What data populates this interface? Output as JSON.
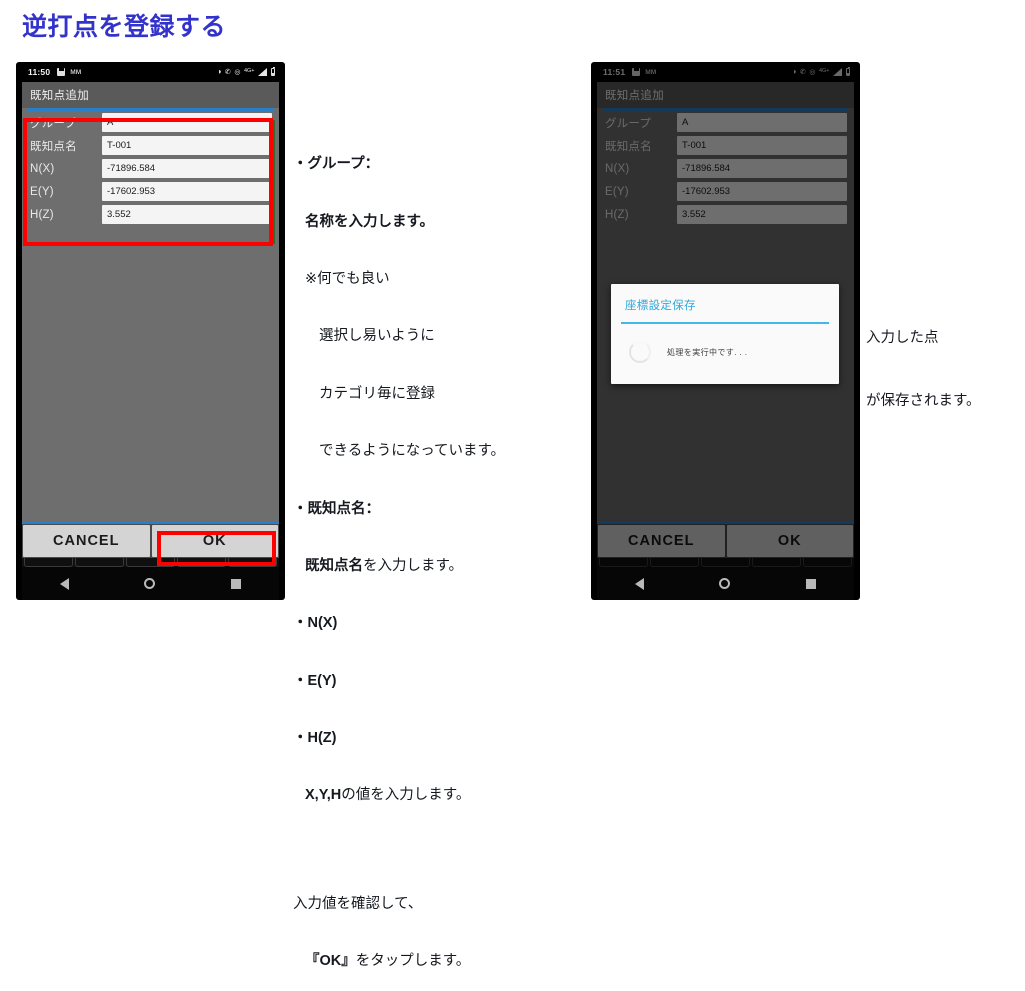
{
  "page": {
    "title": "逆打点を登録する"
  },
  "phone1": {
    "status": {
      "time": "11:50",
      "icons_left": [
        "save-icon",
        "m-logo-icon"
      ],
      "icons_right": [
        "do-not-disturb-icon",
        "phone-icon",
        "alarm-icon",
        "network-4g-plus-icon",
        "signal-icon",
        "battery-icon"
      ],
      "network_label": "4G+"
    },
    "appbar": {
      "title": "既知点追加"
    },
    "form": {
      "rows": [
        {
          "label": "グループ",
          "value": "A"
        },
        {
          "label": "既知点名",
          "value": "T-001"
        },
        {
          "label": "N(X)",
          "value": "-71896.584"
        },
        {
          "label": "E(Y)",
          "value": "-17602.953"
        },
        {
          "label": "H(Z)",
          "value": "3.552"
        }
      ]
    },
    "buttons": {
      "cancel": "CANCEL",
      "ok": "OK"
    },
    "nav": [
      "back-icon",
      "home-icon",
      "recents-icon"
    ]
  },
  "phone2": {
    "status": {
      "time": "11:51",
      "network_label": "4G+"
    },
    "appbar": {
      "title": "既知点追加"
    },
    "form": {
      "rows": [
        {
          "label": "グループ",
          "value": "A"
        },
        {
          "label": "既知点名",
          "value": "T-001"
        },
        {
          "label": "N(X)",
          "value": "-71896.584"
        },
        {
          "label": "E(Y)",
          "value": "-17602.953"
        },
        {
          "label": "H(Z)",
          "value": "3.552"
        }
      ]
    },
    "dialog": {
      "title": "座標設定保存",
      "message": "処理を実行中です. . ."
    },
    "buttons": {
      "cancel": "CANCEL",
      "ok": "OK"
    },
    "nav": [
      "back-icon",
      "home-icon",
      "recents-icon"
    ]
  },
  "annotations": {
    "main": {
      "l1": "・グループ：",
      "l2": "名称を入力します。",
      "l3": "※何でも良い",
      "l4": "選択し易いように",
      "l5": "カテゴリ毎に登録",
      "l6": "できるようになっています。",
      "l7": "・既知点名：",
      "l8a": "既知点名",
      "l8b": "を入力します。",
      "l9": "・N(X)",
      "l10": "・E(Y)",
      "l11": "・H(Z)",
      "l12a": "X,Y,H",
      "l12b": "の値を入力します。",
      "l13": "入力値を確認して、",
      "l14a": "『OK』",
      "l14b": "をタップします。"
    },
    "right": {
      "l1": "入力した点",
      "l2": "が保存されます。"
    }
  },
  "colors": {
    "title": "#3333cc",
    "highlight": "#ff0000",
    "accent": "#2a7fc9",
    "dialog_accent": "#43b7e8"
  }
}
